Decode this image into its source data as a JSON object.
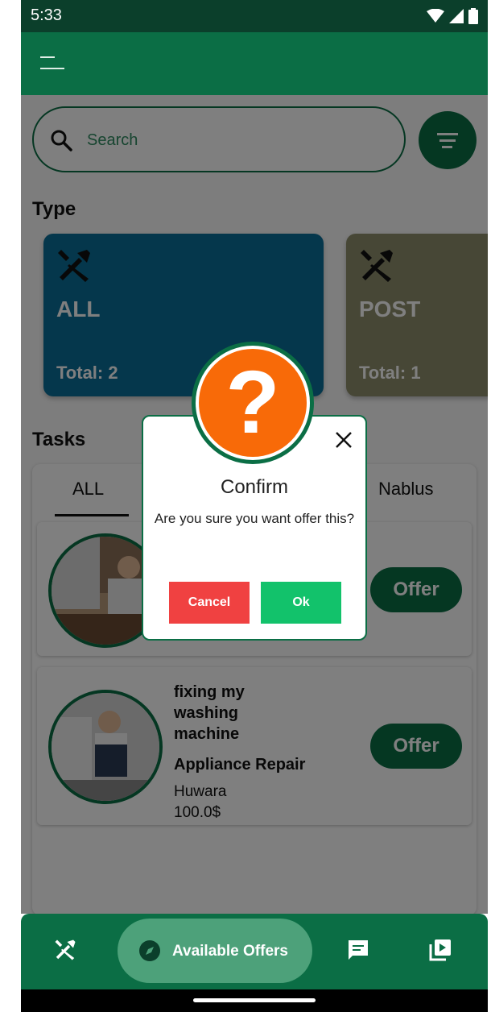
{
  "status_bar": {
    "time": "5:33"
  },
  "search": {
    "placeholder": "Search"
  },
  "sections": {
    "type_title": "Type",
    "tasks_title": "Tasks"
  },
  "types": [
    {
      "name": "ALL",
      "total": "Total: 2",
      "color": "#0a6f99"
    },
    {
      "name": "POST",
      "total": "Total: 1",
      "color": "#8e8f6c"
    }
  ],
  "tabs": [
    {
      "label": "ALL",
      "selected": true
    },
    {
      "label": "Nablus",
      "selected": false
    }
  ],
  "tasks": [
    {
      "title": "",
      "category": "",
      "location": "",
      "price": "",
      "offer_label": "Offer"
    },
    {
      "title": "fixing my washing machine",
      "category": "Appliance Repair",
      "location": "Huwara",
      "price": "100.0$",
      "offer_label": "Offer"
    }
  ],
  "dialog": {
    "title": "Confirm",
    "message": "Are you sure you want offer this?",
    "cancel_label": "Cancel",
    "ok_label": "Ok",
    "icon": "question-icon"
  },
  "bottom_nav": {
    "active_label": "Available Offers"
  },
  "colors": {
    "primary": "#0b6e45",
    "status_bar": "#0b3f2b",
    "cancel": "#f04141",
    "ok": "#12c26b",
    "question": "#f86a08"
  }
}
